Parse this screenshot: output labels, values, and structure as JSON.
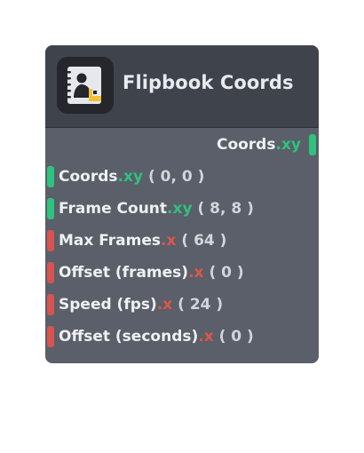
{
  "node": {
    "title": "Flipbook Coords",
    "icon": "flipbook-image-icon",
    "colors": {
      "header": "#3f434c",
      "body": "#5a5f69",
      "vector2_pin": "#2ec27e",
      "float_pin": "#d9534f"
    },
    "outputs": [
      {
        "name": "Coords",
        "suffix": ".xy",
        "type": "vector2"
      }
    ],
    "inputs": [
      {
        "name": "Coords",
        "suffix": ".xy",
        "value": "( 0, 0 )",
        "type": "vector2"
      },
      {
        "name": "Frame Count",
        "suffix": ".xy",
        "value": "( 8, 8 )",
        "type": "vector2"
      },
      {
        "name": "Max Frames",
        "suffix": ".x",
        "value": "( 64 )",
        "type": "float"
      },
      {
        "name": "Offset (frames)",
        "suffix": ".x",
        "value": "( 0 )",
        "type": "float"
      },
      {
        "name": "Speed (fps)",
        "suffix": ".x",
        "value": "( 24 )",
        "type": "float"
      },
      {
        "name": "Offset (seconds)",
        "suffix": ".x",
        "value": "( 0 )",
        "type": "float"
      }
    ]
  }
}
